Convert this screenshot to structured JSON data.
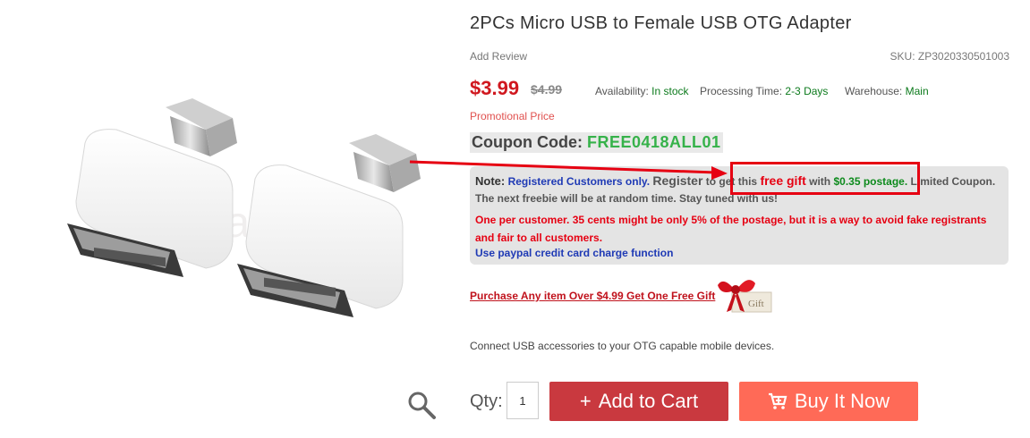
{
  "product": {
    "title": "2PCs Micro USB to Female USB OTG Adapter",
    "add_review": "Add Review",
    "sku_label": "SKU:",
    "sku": "ZP3020330501003",
    "price": "$3.99",
    "old_price": "$4.99",
    "availability_label": "Availability:",
    "availability": "In stock",
    "processing_label": "Processing Time:",
    "processing": "2-3 Days",
    "warehouse_label": "Warehouse:",
    "warehouse": "Main",
    "promo": "Promotional Price",
    "coupon_label": "Coupon Code:",
    "coupon_code": "FREE0418ALL01",
    "description": "Connect USB accessories to your OTG capable mobile devices."
  },
  "gallery": {
    "watermark": "zapals",
    "zoom_icon": "magnifier-icon"
  },
  "note": {
    "label": "Note:",
    "registered": "Registered Customers only.",
    "register": "Register",
    "to_get": "to get this",
    "free_gift": "free gift",
    "with": "with",
    "postage": "$0.35 postage.",
    "limited": "Limited Coupon.",
    "line2": "The next freebie will be at random time. Stay tuned with us!",
    "line3": "One per customer. 35 cents might be only 5% of the postage, but it is a way to avoid fake registrants and fair to all customers.",
    "line5": "Use paypal credit card charge function"
  },
  "promo_link": "Purchase Any item Over $4.99 Get One Free Gift",
  "gift_tag": "Gift",
  "cart": {
    "qty_label": "Qty:",
    "qty_value": "1",
    "add_to_cart": "Add to Cart",
    "buy_now": "Buy It Now"
  },
  "colors": {
    "price": "#d0181f",
    "add_to_cart": "#c9393f",
    "buy_now": "#ff6a57",
    "coupon_code": "#36b24a",
    "annotation": "#e60012"
  }
}
